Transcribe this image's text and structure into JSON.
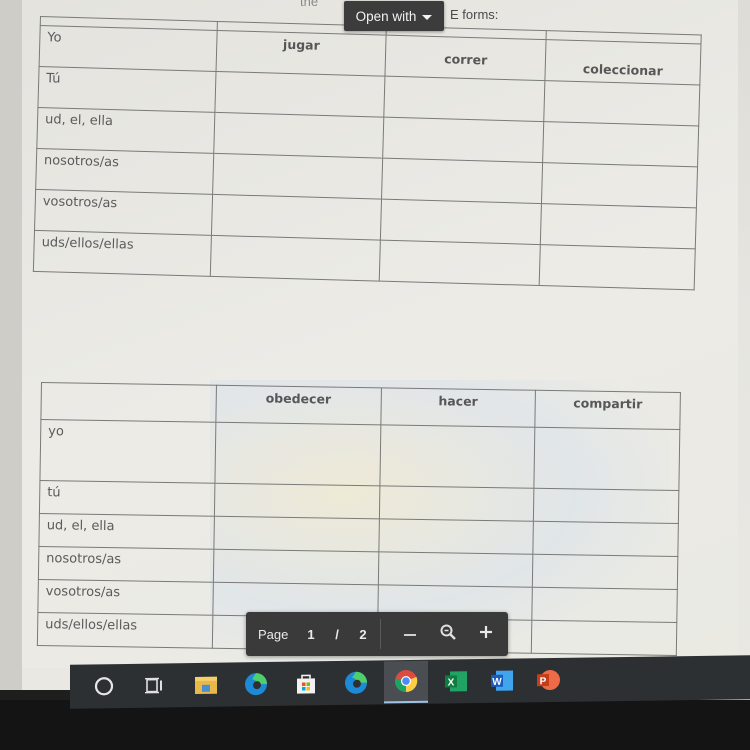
{
  "viewer": {
    "instruction_left": "the",
    "instruction_right": "E forms:",
    "open_with_label": "Open with"
  },
  "table1": {
    "headers": [
      "",
      "jugar",
      "correr",
      "coleccionar"
    ],
    "rows": [
      "Yo",
      "Tú",
      "ud, el, ella",
      "nosotros/as",
      "vosotros/as",
      "uds/ellos/ellas"
    ]
  },
  "table2": {
    "headers": [
      "",
      "obedecer",
      "hacer",
      "compartir"
    ],
    "rows": [
      "yo",
      "tú",
      "ud, el, ella",
      "nosotros/as",
      "vosotros/as",
      "uds/ellos/ellas"
    ]
  },
  "pager": {
    "page_label": "Page",
    "current_page": "1",
    "separator": "/",
    "total_pages": "2",
    "zoom_out_icon": "minus-icon",
    "zoom_icon": "magnifier-icon",
    "zoom_in_icon": "plus-icon"
  },
  "taskbar": {
    "items": [
      {
        "name": "search-cortana",
        "icon": "circle-icon"
      },
      {
        "name": "task-view",
        "icon": "task-view-icon"
      },
      {
        "name": "file-explorer",
        "icon": "folder-icon"
      },
      {
        "name": "edge",
        "icon": "edge-icon"
      },
      {
        "name": "microsoft-store",
        "icon": "store-icon"
      },
      {
        "name": "edge-2",
        "icon": "edge-icon"
      },
      {
        "name": "chrome",
        "icon": "chrome-icon",
        "active": true
      },
      {
        "name": "excel",
        "icon": "excel-icon",
        "letter": "X"
      },
      {
        "name": "word",
        "icon": "word-icon",
        "letter": "W"
      },
      {
        "name": "powerpoint",
        "icon": "powerpoint-icon",
        "letter": "P"
      }
    ]
  },
  "colors": {
    "toolbar_bg": "#3a3a3a",
    "taskbar_bg": "#2d3033",
    "excel": "#1f7a3f",
    "word": "#2b5fb8",
    "powerpoint": "#c8452a"
  }
}
